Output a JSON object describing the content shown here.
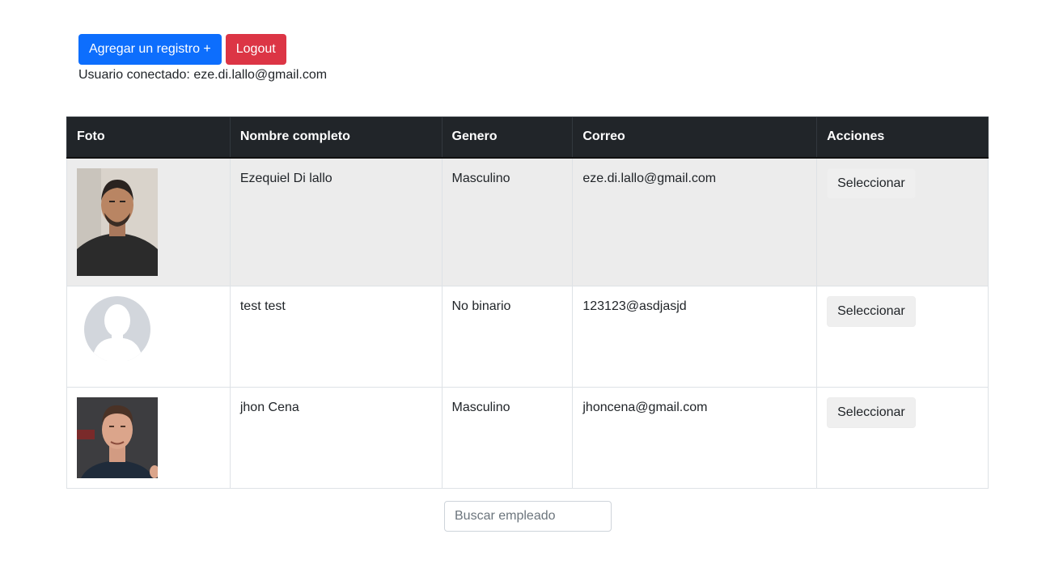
{
  "toolbar": {
    "add_label": "Agregar un registro +",
    "logout_label": "Logout",
    "user_prefix": "Usuario conectado: ",
    "user_email": "eze.di.lallo@gmail.com"
  },
  "table": {
    "headers": [
      "Foto",
      "Nombre completo",
      "Genero",
      "Correo",
      "Acciones"
    ],
    "rows": [
      {
        "photo": "person-photo",
        "name": "Ezequiel Di lallo",
        "gender": "Masculino",
        "email": "eze.di.lallo@gmail.com",
        "action": "Seleccionar"
      },
      {
        "photo": "default-avatar",
        "name": "test test",
        "gender": "No binario",
        "email": "123123@asdjasjd",
        "action": "Seleccionar"
      },
      {
        "photo": "person-photo",
        "name": "jhon Cena",
        "gender": "Masculino",
        "email": "jhoncena@gmail.com",
        "action": "Seleccionar"
      }
    ]
  },
  "search": {
    "placeholder": "Buscar empleado",
    "value": ""
  },
  "colors": {
    "primary": "#0d6efd",
    "danger": "#dc3545",
    "header_bg": "#212529",
    "stripe_bg": "#ececec"
  }
}
